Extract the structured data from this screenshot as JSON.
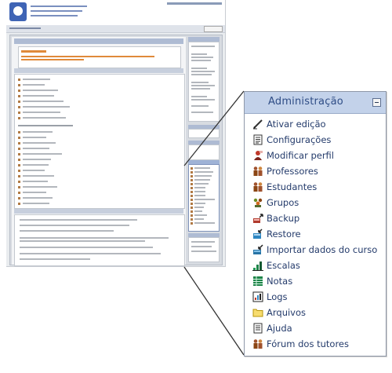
{
  "admin_panel": {
    "title": "Administração",
    "items": [
      {
        "label": "Ativar edição",
        "icon": "pencil-icon"
      },
      {
        "label": "Configurações",
        "icon": "document-icon"
      },
      {
        "label": "Modificar perfil",
        "icon": "profile-icon"
      },
      {
        "label": "Professores",
        "icon": "people-icon"
      },
      {
        "label": "Estudantes",
        "icon": "people-icon"
      },
      {
        "label": "Grupos",
        "icon": "group-icon"
      },
      {
        "label": "Backup",
        "icon": "backup-icon"
      },
      {
        "label": "Restore",
        "icon": "restore-icon"
      },
      {
        "label": "Importar dados do curso",
        "icon": "import-icon"
      },
      {
        "label": "Escalas",
        "icon": "scales-icon"
      },
      {
        "label": "Notas",
        "icon": "grades-icon"
      },
      {
        "label": "Logs",
        "icon": "logs-icon"
      },
      {
        "label": "Arquivos",
        "icon": "folder-icon"
      },
      {
        "label": "Ajuda",
        "icon": "help-icon"
      },
      {
        "label": "Fórum dos tutores",
        "icon": "people-icon"
      }
    ]
  },
  "colors": {
    "header_bg": "#c3d2ea",
    "title": "#2f4d86",
    "link": "#243b6b",
    "border": "#8f98a8"
  }
}
